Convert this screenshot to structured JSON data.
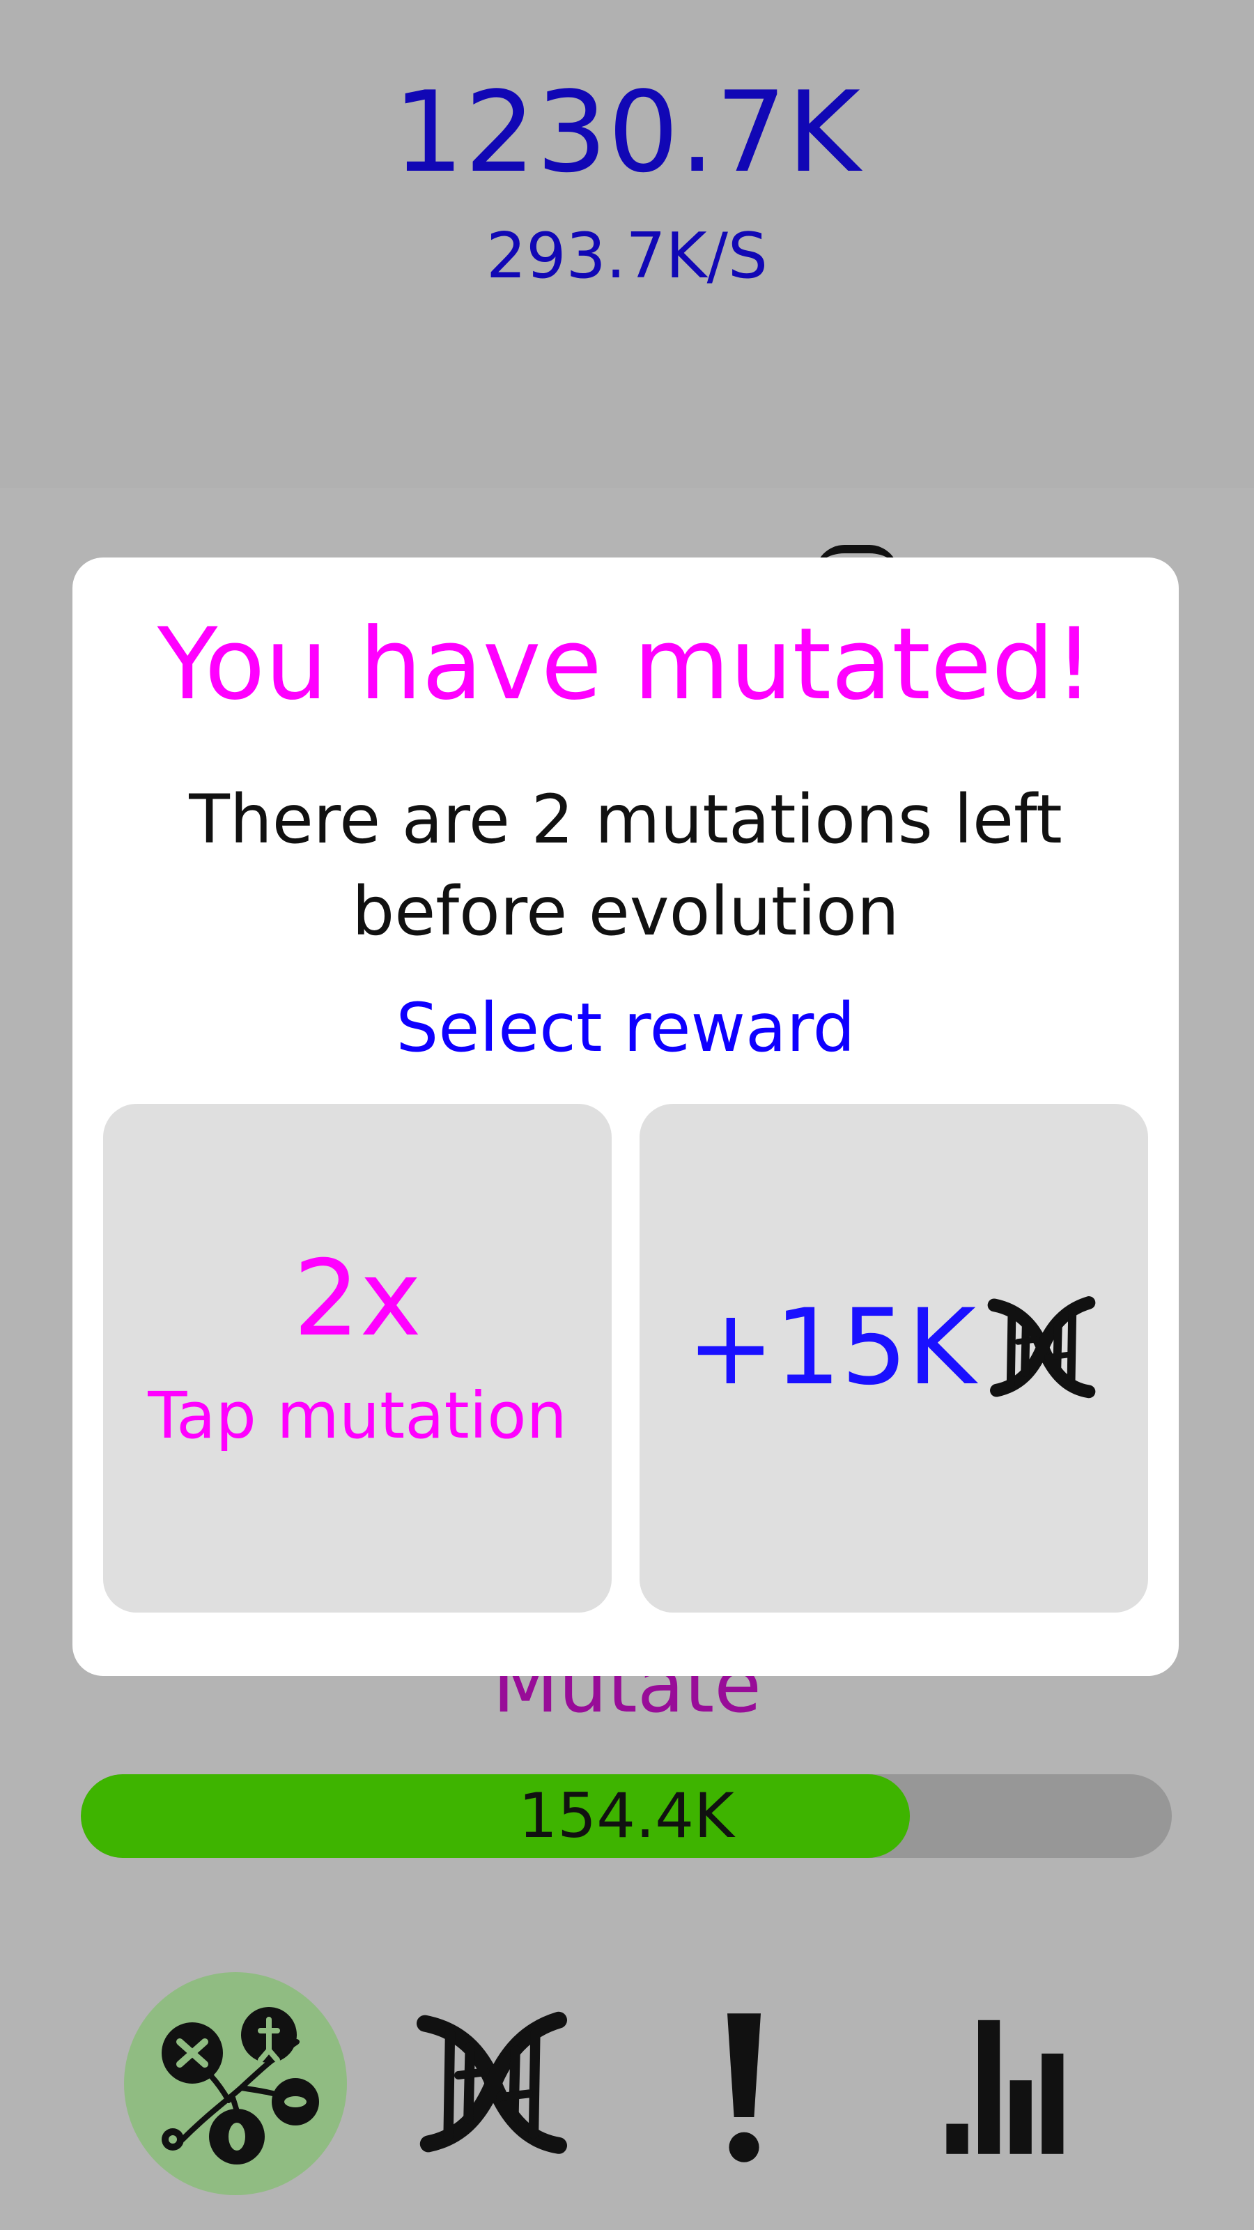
{
  "header": {
    "score": "1230.7K",
    "rate": "293.7K/S"
  },
  "game": {
    "mutate_label": "Mutate",
    "progress": {
      "value_text": "154.4K",
      "fraction": 0.76
    }
  },
  "modal": {
    "title": "You have mutated!",
    "message": "There are 2 mutations left before evolution",
    "select_label": "Select reward",
    "rewards": [
      {
        "main": "2x",
        "sub": "Tap mutation"
      },
      {
        "main": "+15K",
        "icon": "dna-icon"
      }
    ]
  },
  "nav": {
    "items": [
      {
        "icon": "evolution-tree-icon",
        "active": true
      },
      {
        "icon": "dna-icon",
        "active": false
      },
      {
        "icon": "exclamation-icon",
        "active": false
      },
      {
        "icon": "bar-chart-icon",
        "active": false
      }
    ]
  },
  "colors": {
    "score_text": "#1107b5",
    "modal_title": "#ff00ff",
    "select_reward": "#0f00ff",
    "mutate_text": "#980c98",
    "progress_fill": "#3eb400",
    "progress_track": "#979797",
    "nav_active": "#90bc82",
    "background": "#b2b2b2"
  }
}
